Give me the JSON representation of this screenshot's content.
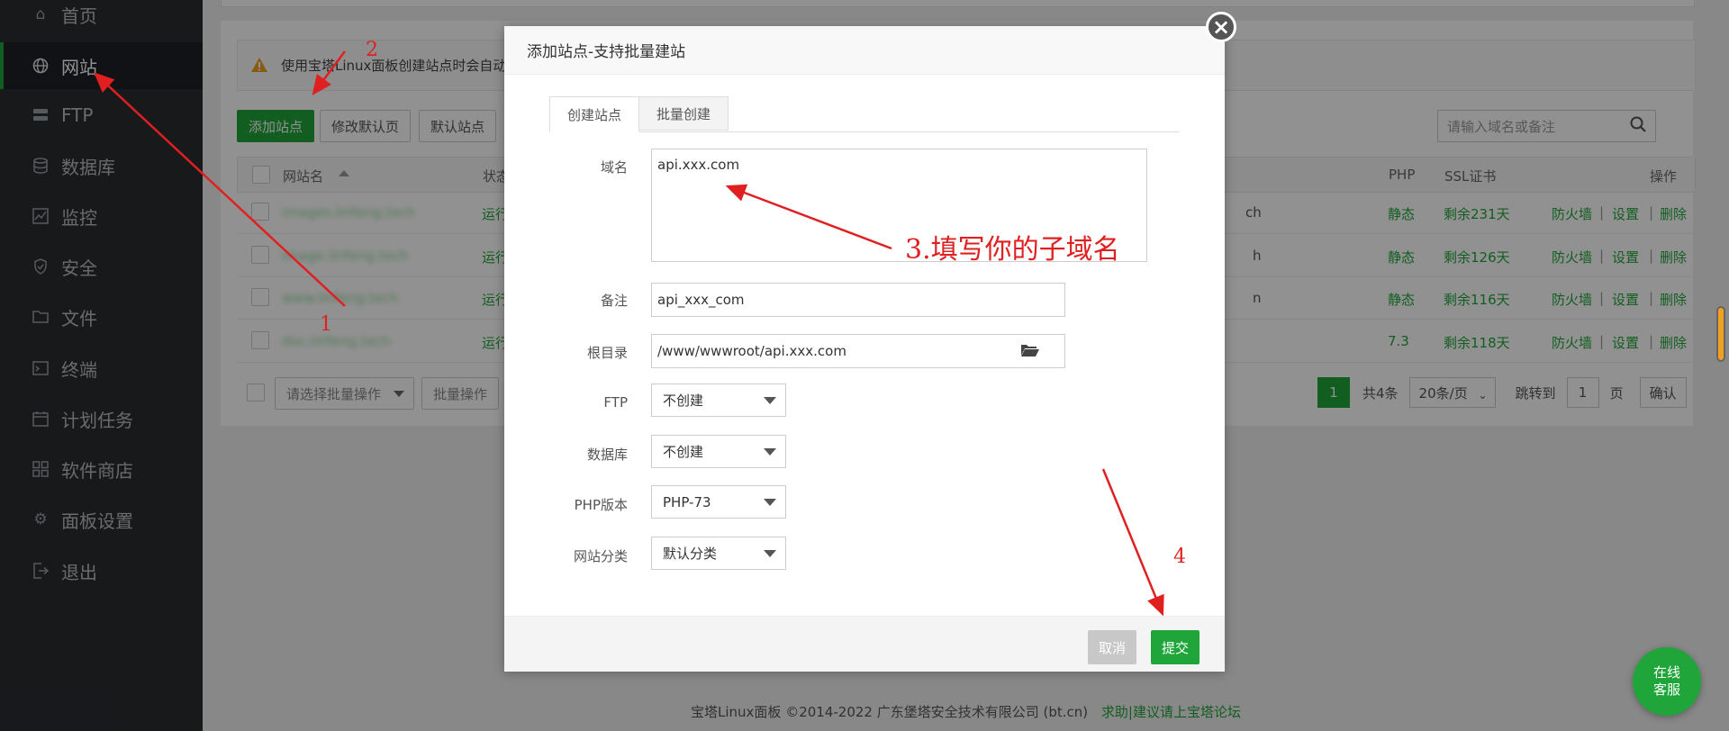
{
  "sidebar": {
    "items": [
      {
        "label": "首页",
        "icon": "home-icon"
      },
      {
        "label": "网站",
        "icon": "globe-icon",
        "active": true
      },
      {
        "label": "FTP",
        "icon": "ftp-icon"
      },
      {
        "label": "数据库",
        "icon": "database-icon"
      },
      {
        "label": "监控",
        "icon": "monitor-icon"
      },
      {
        "label": "安全",
        "icon": "shield-icon"
      },
      {
        "label": "文件",
        "icon": "folder-icon"
      },
      {
        "label": "终端",
        "icon": "terminal-icon"
      },
      {
        "label": "计划任务",
        "icon": "calendar-icon"
      },
      {
        "label": "软件商店",
        "icon": "apps-icon"
      },
      {
        "label": "面板设置",
        "icon": "gear-icon"
      },
      {
        "label": "退出",
        "icon": "logout-icon"
      }
    ]
  },
  "main": {
    "notice": "使用宝塔Linux面板创建站点时会自动",
    "toolbar": {
      "add_site": "添加站点",
      "edit_default_page": "修改默认页",
      "default_site": "默认站点"
    },
    "search_placeholder": "请输入域名或备注",
    "table": {
      "headers": {
        "name": "网站名",
        "status": "状态",
        "php": "PHP",
        "ssl": "SSL证书",
        "ops": "操作"
      },
      "rows": [
        {
          "name": "images.linfeng.tech",
          "status": "运行",
          "fragment": "ch",
          "php": "静态",
          "ssl": "剩余231天"
        },
        {
          "name": "image.linfeng.tech",
          "status": "运行",
          "fragment": "h",
          "php": "静态",
          "ssl": "剩余126天"
        },
        {
          "name": "www.linfeng.tech",
          "status": "运行",
          "fragment": "n",
          "php": "静态",
          "ssl": "剩余116天"
        },
        {
          "name": "doc.linfeng.tech",
          "status": "运行",
          "fragment": "",
          "php": "7.3",
          "ssl": "剩余118天"
        }
      ],
      "ops": {
        "firewall": "防火墙",
        "settings": "设置",
        "delete": "删除",
        "sep": "|"
      }
    },
    "batch": {
      "select_placeholder": "请选择批量操作",
      "button": "批量操作"
    },
    "pager": {
      "current": "1",
      "total": "共4条",
      "per_page": "20条/页",
      "goto_label": "跳转到",
      "goto_value": "1",
      "page_unit": "页",
      "confirm": "确认"
    },
    "footer": {
      "copyright": "宝塔Linux面板 ©2014-2022 广东堡塔安全技术有限公司 (bt.cn)",
      "link": "求助|建议请上宝塔论坛"
    }
  },
  "modal": {
    "title": "添加站点-支持批量建站",
    "tabs": [
      "创建站点",
      "批量创建"
    ],
    "fields": {
      "domain": {
        "label": "域名",
        "value": "api.xxx.com"
      },
      "remark": {
        "label": "备注",
        "value": "api_xxx_com"
      },
      "root": {
        "label": "根目录",
        "value": "/www/wwwroot/api.xxx.com"
      },
      "ftp": {
        "label": "FTP",
        "value": "不创建"
      },
      "database": {
        "label": "数据库",
        "value": "不创建"
      },
      "php": {
        "label": "PHP版本",
        "value": "PHP-73"
      },
      "category": {
        "label": "网站分类",
        "value": "默认分类"
      }
    },
    "cancel": "取消",
    "submit": "提交"
  },
  "annotations": {
    "a1": "1",
    "a2": "2",
    "a3": "3.填写你的子域名",
    "a4": "4"
  },
  "chat": {
    "line1": "在线",
    "line2": "客服"
  }
}
